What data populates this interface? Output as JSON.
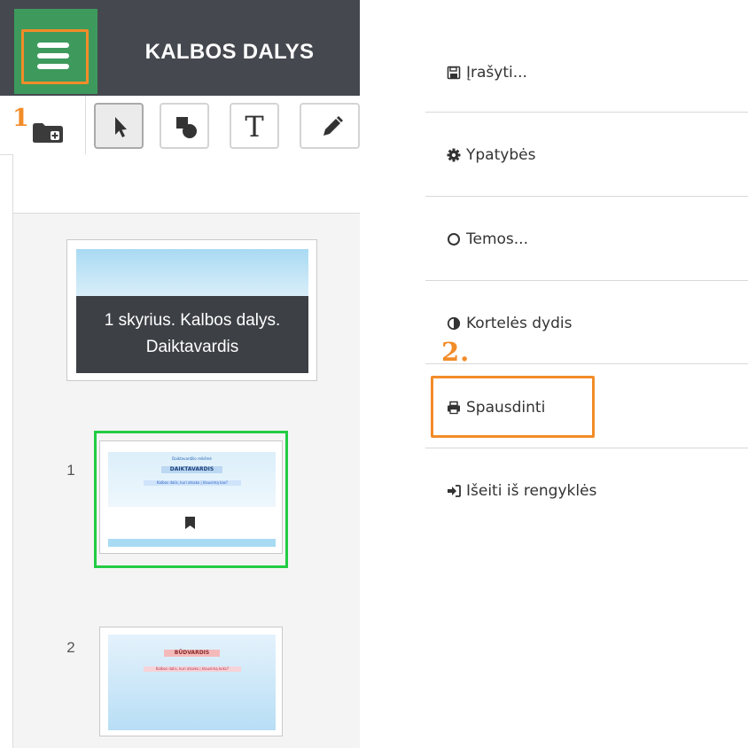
{
  "header": {
    "title": "KALBOS DALYS"
  },
  "annotations": {
    "step1": "1",
    "step2": "2."
  },
  "toolbar": {
    "tools": [
      "pointer-icon",
      "shapes-icon",
      "text-icon",
      "pencil-icon"
    ],
    "text_tool_glyph": "T"
  },
  "slides": {
    "title_card": {
      "line1": "1 skyrius. Kalbos dalys.",
      "line2": "Daiktavardis"
    },
    "items": [
      {
        "number": "1",
        "heading": "DAIKTAVARDIS",
        "subtitle": "Kalbos dalis, kuri atsako į klausimą kas?",
        "small": "Daiktavardžio reikšmė"
      },
      {
        "number": "2",
        "heading": "BŪDVARDIS",
        "subtitle": "Kalbos dalis, kuri atsako į klausimą koks?"
      }
    ]
  },
  "menu": {
    "items": [
      {
        "label": "Įrašyti...",
        "icon": "save-icon"
      },
      {
        "label": "Ypatybės",
        "icon": "gear-icon"
      },
      {
        "label": "Temos...",
        "icon": "circle-icon"
      },
      {
        "label": "Kortelės dydis",
        "icon": "half-circle-icon"
      },
      {
        "label": "Spausdinti",
        "icon": "print-icon"
      },
      {
        "label": "Išeiti iš rengyklės",
        "icon": "sign-out-icon"
      }
    ]
  },
  "colors": {
    "header_bg": "#45484e",
    "menu_tile": "#3d9a5c",
    "highlight_orange": "#f28c28",
    "selection_green": "#22cc44"
  }
}
